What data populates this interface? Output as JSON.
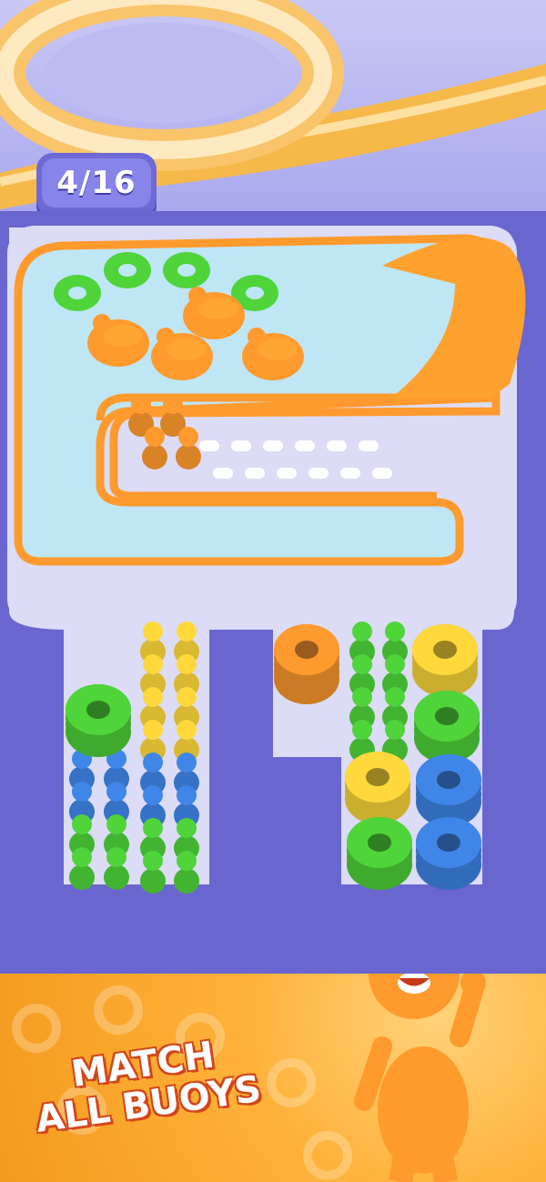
{
  "level": {
    "counter_text": "4/16"
  },
  "promo": {
    "line1": "MATCH",
    "line2": "ALL BUOYS"
  },
  "colors": {
    "orange": "#ff9a2e",
    "green": "#4fd43a",
    "yellow": "#ffd93b",
    "blue": "#3f86e8",
    "board": "#dcdcf6",
    "frame": "#6a66cf"
  },
  "pool": {
    "floating_rings": [
      "green",
      "green",
      "green",
      "green"
    ],
    "riders_on_rings": [
      "orange",
      "orange",
      "orange",
      "orange"
    ],
    "queue_people": [
      "orange",
      "orange",
      "orange",
      "orange"
    ]
  },
  "left_slot": {
    "columns": [
      [
        "yellow",
        "yellow",
        "yellow",
        "yellow",
        "blue",
        "blue",
        "green",
        "green"
      ],
      [
        "yellow",
        "yellow",
        "yellow",
        "yellow",
        "blue",
        "blue",
        "green",
        "green"
      ]
    ],
    "ring_stack": "green"
  },
  "right_slot": {
    "people_columns": [
      "green",
      "green"
    ],
    "ring_stacks": [
      "orange",
      "yellow",
      "green",
      "yellow",
      "blue",
      "green",
      "blue"
    ]
  }
}
